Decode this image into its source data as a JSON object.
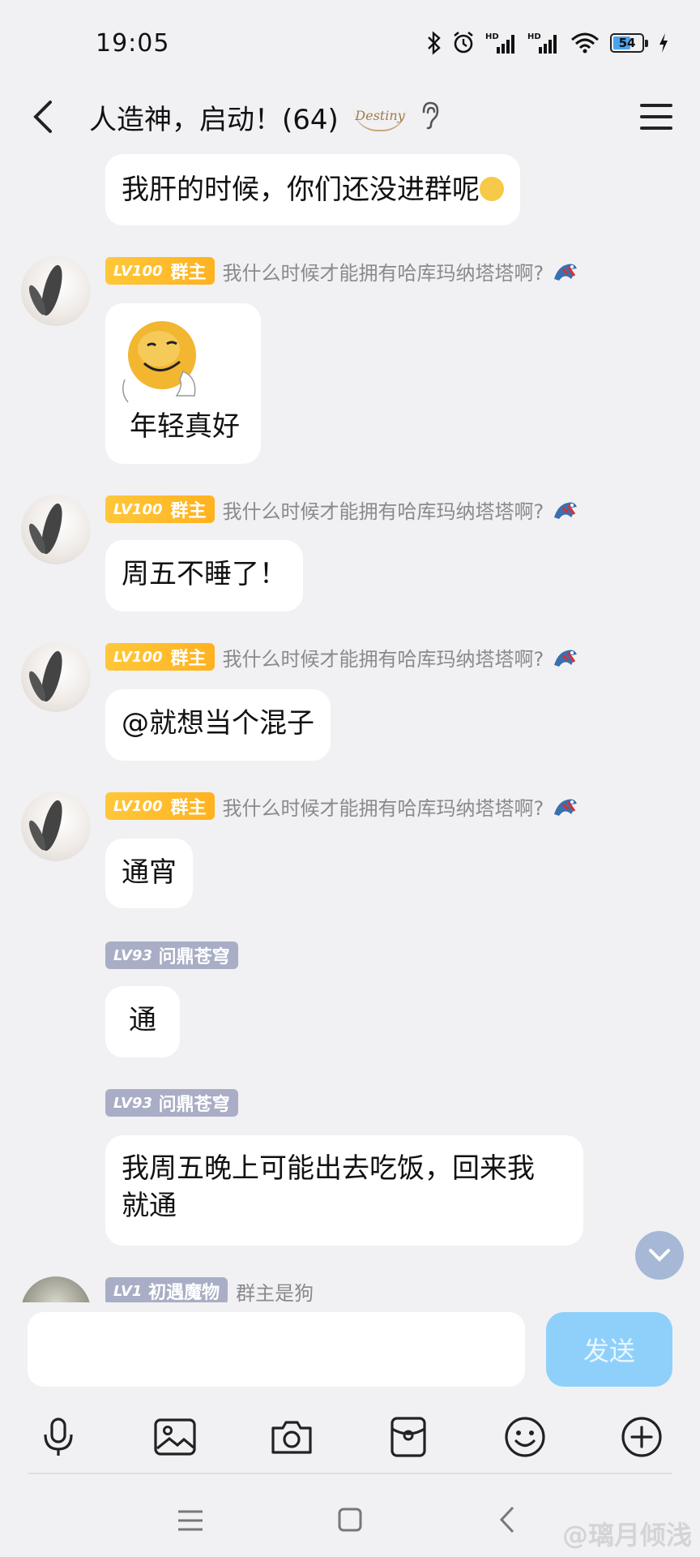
{
  "status_bar": {
    "time": "19:05",
    "battery": "54"
  },
  "header": {
    "title": "人造神，启动！(64)",
    "badge": "Destiny"
  },
  "messages": [
    {
      "text": "我肝的时候，你们还没进群呢"
    },
    {
      "level": "LV100",
      "role": "群主",
      "nickname": "我什么时候才能拥有哈库玛纳塔塔啊?",
      "sticker_caption": "年轻真好"
    },
    {
      "level": "LV100",
      "role": "群主",
      "nickname": "我什么时候才能拥有哈库玛纳塔塔啊?",
      "text": "周五不睡了！"
    },
    {
      "level": "LV100",
      "role": "群主",
      "nickname": "我什么时候才能拥有哈库玛纳塔塔啊?",
      "text": "@就想当个混子"
    },
    {
      "level": "LV100",
      "role": "群主",
      "nickname": "我什么时候才能拥有哈库玛纳塔塔啊?",
      "text": "通宵"
    },
    {
      "level": "LV93",
      "nickname": "问鼎苍穹",
      "text": "通"
    },
    {
      "level": "LV93",
      "nickname": "问鼎苍穹",
      "text_line1": "我周五晚上可能出去吃饭，回来我",
      "text_line2": "就通"
    },
    {
      "level": "LV1",
      "role": "初遇魔物",
      "nickname": "群主是狗"
    }
  ],
  "input": {
    "placeholder": "",
    "send_label": "发送"
  },
  "toolbar_icons": [
    "microphone-icon",
    "image-icon",
    "camera-icon",
    "red-packet-icon",
    "emoji-icon",
    "plus-icon"
  ],
  "watermark": "@璃月倾浅",
  "colors": {
    "level_gold": "#ffb21f",
    "level_gray": "#a9aec6",
    "send_button": "#8fd0fb"
  }
}
